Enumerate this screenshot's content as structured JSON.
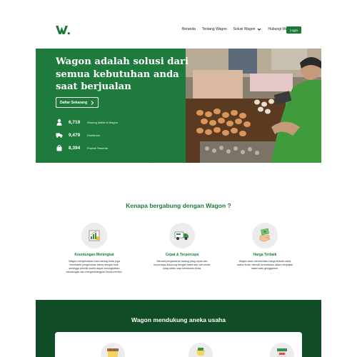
{
  "brand": {
    "name": "W.",
    "color": "#1b7a3a",
    "dark": "#104d27"
  },
  "nav": {
    "items": [
      "Beranda",
      "Tentang Wagon",
      "Solusi Wagon",
      "Hubungi Wagon"
    ],
    "login": "Login"
  },
  "hero": {
    "title": "Wagon adalah solusi dari semua kebutuhan anda saat berjualan",
    "cta": "Daftar Sekarang",
    "stats": [
      {
        "icon": "person-icon",
        "value": "6,719",
        "label": "Warung daftar di Wagon"
      },
      {
        "icon": "truck-icon",
        "value": "9,479",
        "label": "Distributor"
      },
      {
        "icon": "bag-icon",
        "value": "8,394",
        "label": "Produk Tersedia"
      }
    ]
  },
  "why": {
    "title": "Kenapa bergabung dengan Wagon ?",
    "features": [
      {
        "icon": "chart-icon",
        "title": "Keuntungan Meningkat",
        "desc": "Wagon mengelolakan stok barang Anda juga membantu pengelolaan bisnis dengan baik, sehingga pemilik usaha dapat meningkatkan keuntungan dan mengembangkan bisnis mereka."
      },
      {
        "icon": "delivery-truck-icon",
        "title": "Cepat & Terpercaya",
        "desc": "Nikmati pengantaran barang yang cepat dan terpercaya didukung dengan sales dan call center yang selalu siap membantu Anda."
      },
      {
        "icon": "money-hand-icon",
        "title": "Harga Terbaik",
        "desc": "Wagon akan memberikan harga terbaik untuk usaha Anda, nikmati kemudahan dalam berjualan dalam satu genggaman."
      }
    ]
  },
  "support": {
    "title": "Wagon mendukung aneka usaha"
  }
}
